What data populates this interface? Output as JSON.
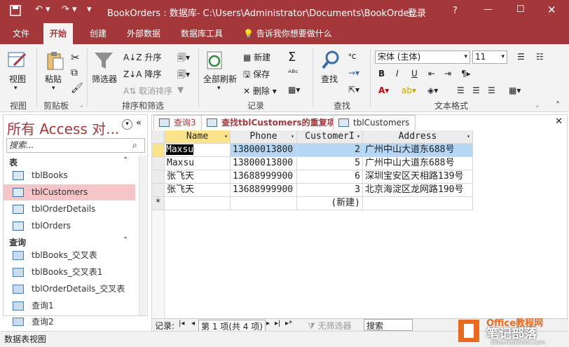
{
  "titlebar": {
    "title": "BookOrders : 数据库- C:\\Users\\Administrator\\Documents\\BookOrder...",
    "login": "登录",
    "help": "?"
  },
  "ribbon_tabs": [
    "文件",
    "开始",
    "创建",
    "外部数据",
    "数据库工具"
  ],
  "tellme": "告诉我你想要做什么",
  "ribbon": {
    "view": "视图",
    "paste": "粘贴",
    "filter": "筛选器",
    "sort_asc": "升序",
    "sort_desc": "降序",
    "remove_sort": "取消排序",
    "refresh_all": "全部刷新",
    "new": "新建",
    "save": "保存",
    "delete": "删除",
    "find": "查找",
    "font_name": "宋体 (主体)",
    "font_size": "11",
    "groups": [
      "视图",
      "剪贴板",
      "排序和筛选",
      "记录",
      "查找",
      "文本格式"
    ]
  },
  "nav": {
    "title": "所有 Access 对...",
    "search_placeholder": "搜索...",
    "sections": [
      {
        "label": "表",
        "items": [
          "tblBooks",
          "tblCustomers",
          "tblOrderDetails",
          "tblOrders"
        ]
      },
      {
        "label": "查询",
        "items": [
          "tblBooks_交叉表",
          "tblBooks_交叉表1",
          "tblOrderDetails_交叉表",
          "查询1",
          "查询2"
        ]
      }
    ],
    "selected": "tblCustomers"
  },
  "doc_tabs": [
    "查询3",
    "查找tblCustomers的重复项",
    "tblCustomers"
  ],
  "grid": {
    "columns": [
      "Name",
      "Phone",
      "CustomerI",
      "Address"
    ],
    "rows": [
      [
        "Maxsu",
        "13800013800",
        "2",
        "广州中山大道东688号"
      ],
      [
        "Maxsu",
        "13800013800",
        "5",
        "广州中山大道东688号"
      ],
      [
        "张飞天",
        "13688999900",
        "6",
        "深圳宝安区天相路139号"
      ],
      [
        "张飞天",
        "13688999900",
        "3",
        "北京海淀区龙网路190号"
      ]
    ],
    "new_row": "(新建)",
    "new_marker": "*"
  },
  "record_nav": {
    "label": "记录:",
    "position": "第 1 项(共 4 项)",
    "filter": "无筛选器",
    "search": "搜索"
  },
  "status": "数据表视图",
  "watermark": {
    "line1": "Office教程网",
    "line2": "笔记部落",
    "url": "www.notetribe.com"
  },
  "colors": {
    "accent": "#a4373a",
    "selection": "#f5c5c7",
    "header_active": "#fbe38c",
    "row_selected": "#b5d6f5"
  }
}
